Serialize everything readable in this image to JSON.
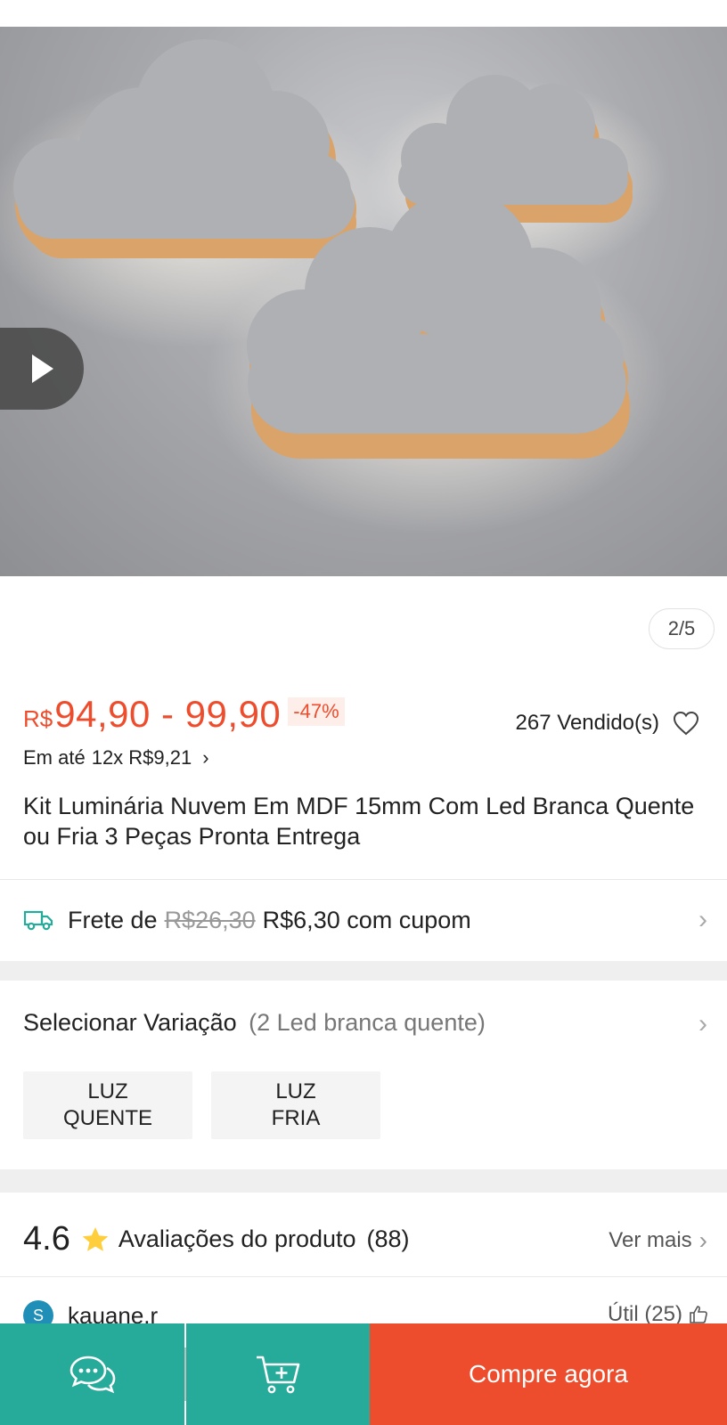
{
  "gallery": {
    "page_indicator": "2/5",
    "play_icon": "play-icon"
  },
  "price": {
    "currency": "R$",
    "range": "94,90 - 99,90",
    "discount": "-47%",
    "sold": "267 Vendido(s)",
    "installment_prefix": "Em até",
    "installment_value": "12x R$9,21",
    "installment_chevron": "›"
  },
  "product": {
    "title": "Kit Luminária Nuvem Em MDF 15mm Com Led Branca Quente ou Fria 3 Peças Pronta Entrega"
  },
  "shipping": {
    "prefix": "Frete de",
    "old_price": "R$26,30",
    "new_price": "R$6,30 com cupom",
    "chevron": "›"
  },
  "variation": {
    "label": "Selecionar Variação",
    "selected": "(2 Led branca quente)",
    "chevron": "›",
    "options": [
      {
        "line1": "LUZ",
        "line2": "QUENTE"
      },
      {
        "line1": "LUZ",
        "line2": "FRIA"
      }
    ]
  },
  "reviews": {
    "score": "4.6",
    "title": "Avaliações do produto",
    "count": "(88)",
    "see_more": "Ver mais",
    "chevron": "›",
    "first_review": {
      "avatar_letter": "S",
      "name": "kauane.r",
      "useful": "Útil (25)"
    }
  },
  "bottom_bar": {
    "buy_label": "Compre agora"
  },
  "colors": {
    "brand_orange": "#ee4d2d",
    "brand_teal": "#26aa99"
  }
}
